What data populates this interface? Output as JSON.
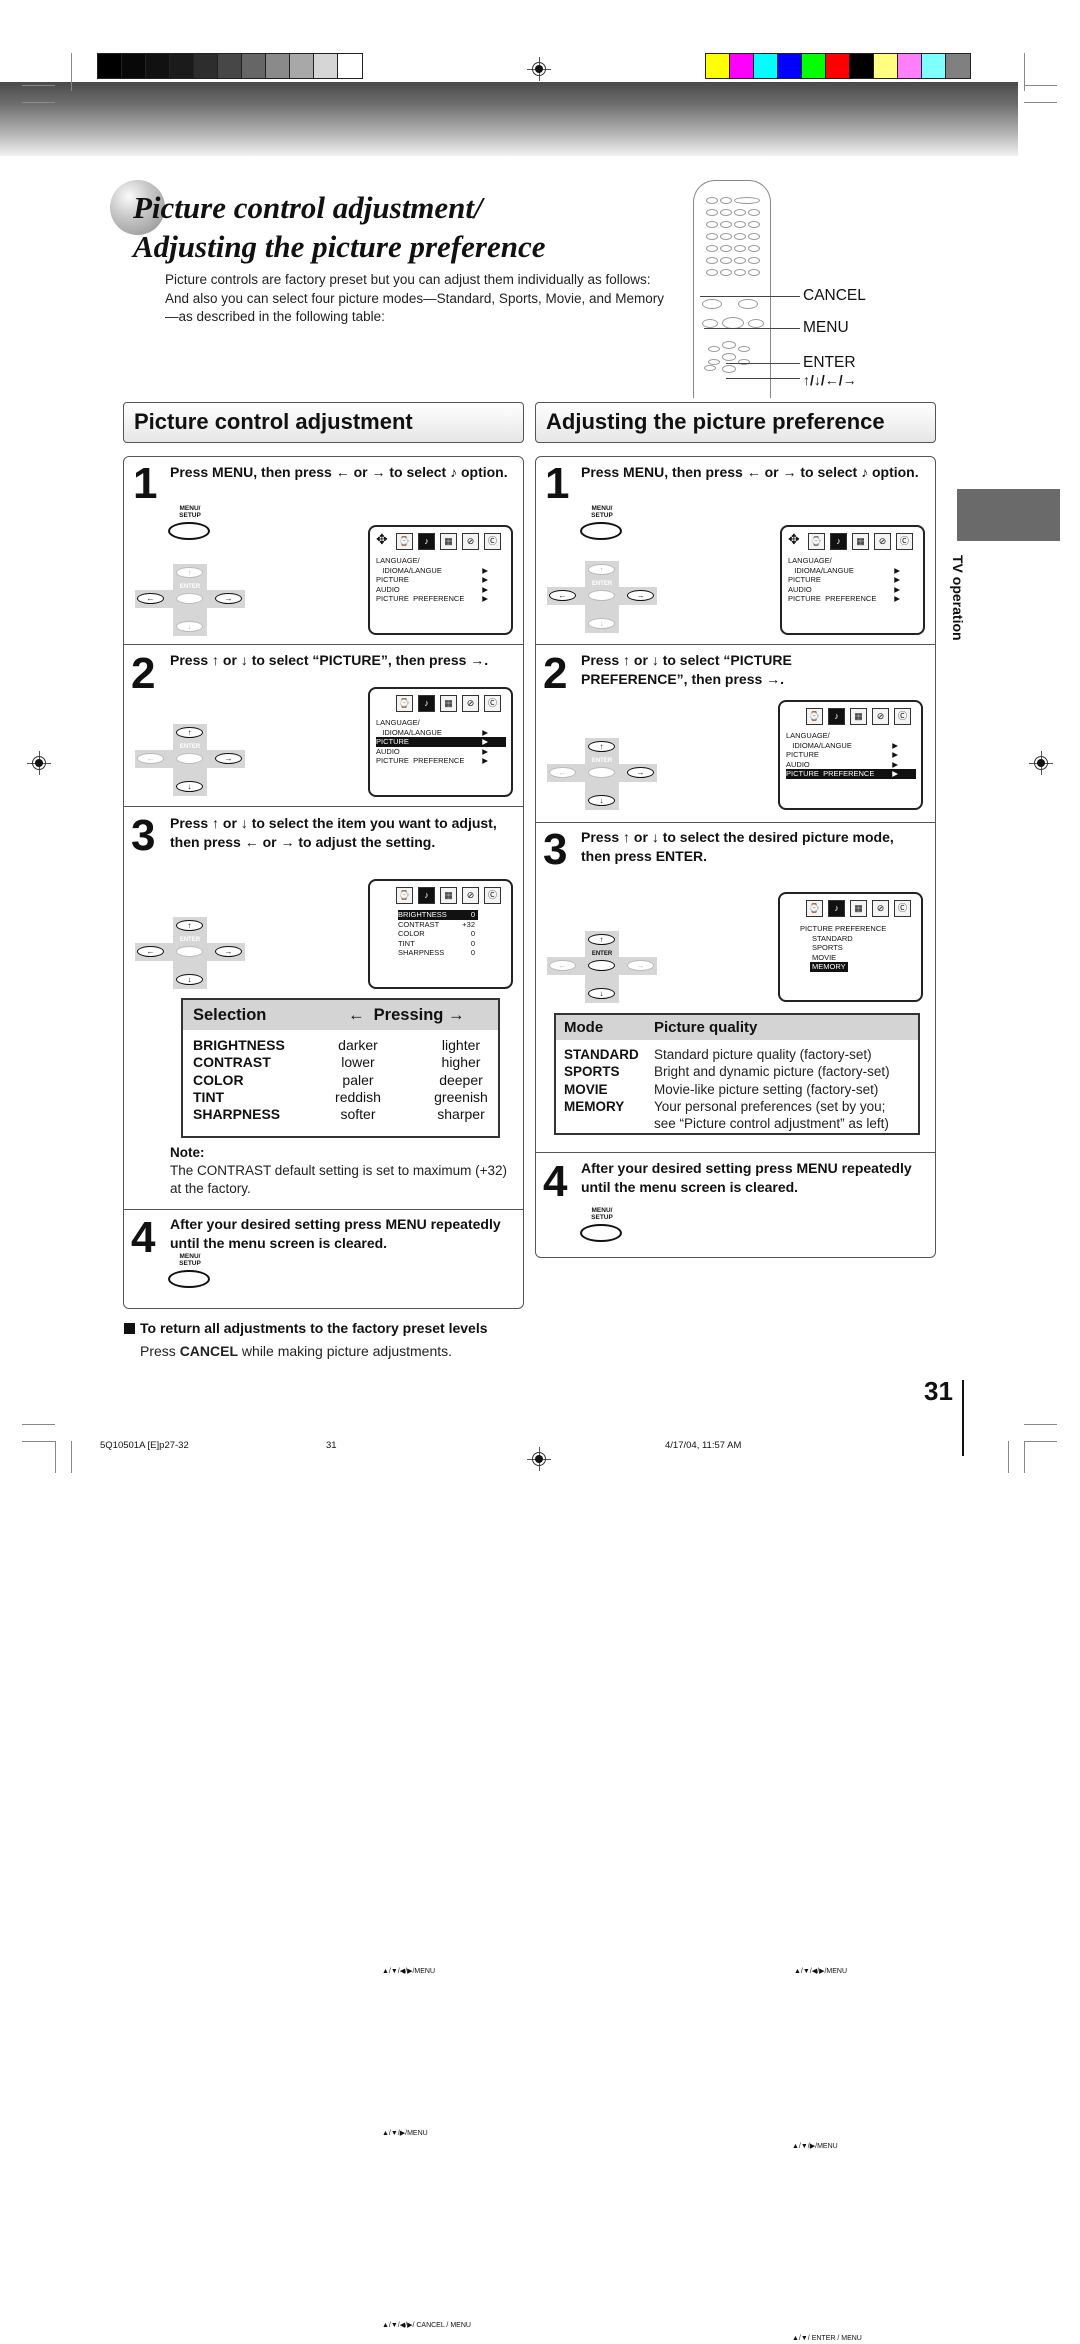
{
  "header": {
    "grayscale_swatches": [
      "#000000",
      "#080808",
      "#111111",
      "#1b1b1b",
      "#2d2d2d",
      "#474747",
      "#666666",
      "#8a8a8a",
      "#a8a8a8",
      "#d6d6d6",
      "#ffffff"
    ],
    "color_swatches": [
      "#ffff00",
      "#ff00ff",
      "#00ffff",
      "#0000ff",
      "#00ff00",
      "#ff0000",
      "#000000",
      "#ffff80",
      "#ff80ff",
      "#80ffff",
      "#808080"
    ]
  },
  "title": {
    "line1": "Picture control adjustment/",
    "line2": "Adjusting the picture preference"
  },
  "intro": {
    "p1": "Picture controls are factory preset but you can adjust them individually as follows:",
    "p2": "And also you can select four picture modes—Standard, Sports, Movie, and Memory—as described in the following table:"
  },
  "remote": {
    "labels": {
      "cancel": "CANCEL",
      "menu": "MENU",
      "enter": "ENTER",
      "arrows": "↑/↓/←/→"
    }
  },
  "left_section": {
    "heading": "Picture control adjustment",
    "steps": [
      {
        "num": "1",
        "text": "Press MENU, then press ← or → to select ♪ option."
      },
      {
        "num": "2",
        "text": "Press ↑ or ↓ to select “PICTURE”, then press →."
      },
      {
        "num": "3",
        "text": "Press ↑ or ↓ to select the item you want to adjust, then press ← or → to adjust the setting."
      },
      {
        "num": "4",
        "text": "After your desired setting press MENU repeatedly until the menu screen is cleared."
      }
    ],
    "selection_table": {
      "headers": {
        "selection": "Selection",
        "pressing": "←  Pressing →"
      },
      "rows": [
        {
          "item": "BRIGHTNESS",
          "left": "darker",
          "right": "lighter"
        },
        {
          "item": "CONTRAST",
          "left": "lower",
          "right": "higher"
        },
        {
          "item": "COLOR",
          "left": "paler",
          "right": "deeper"
        },
        {
          "item": "TINT",
          "left": "reddish",
          "right": "greenish"
        },
        {
          "item": "SHARPNESS",
          "left": "softer",
          "right": "sharper"
        }
      ]
    },
    "note": {
      "heading": "Note:",
      "text": "The CONTRAST default setting is set to maximum (+32) at the factory."
    },
    "factory_reset": {
      "heading": "To return all adjustments to the factory preset levels",
      "text_pre": "Press ",
      "text_bold": "CANCEL",
      "text_post": " while making picture adjustments."
    }
  },
  "right_section": {
    "heading": "Adjusting the picture preference",
    "steps": [
      {
        "num": "1",
        "text": "Press MENU, then press ← or → to select ♪ option."
      },
      {
        "num": "2",
        "text": "Press ↑ or ↓ to select “PICTURE PREFERENCE”, then press →."
      },
      {
        "num": "3",
        "text": "Press ↑ or ↓ to select the desired picture mode, then press ENTER."
      },
      {
        "num": "4",
        "text": "After your desired setting press MENU repeatedly until the menu screen is cleared."
      }
    ],
    "mode_table": {
      "headers": {
        "mode": "Mode",
        "quality": "Picture quality"
      },
      "rows": [
        {
          "mode": "STANDARD",
          "desc": "Standard picture quality (factory-set)"
        },
        {
          "mode": "SPORTS",
          "desc": "Bright and dynamic picture (factory-set)"
        },
        {
          "mode": "MOVIE",
          "desc": "Movie-like picture setting (factory-set)"
        },
        {
          "mode": "MEMORY",
          "desc": "Your personal preferences (set by you;"
        },
        {
          "mode": "",
          "desc": "see “Picture control adjustment” as left)"
        }
      ]
    }
  },
  "controls": {
    "menu_setup_label": "MENU/\nSETUP",
    "enter_label": "ENTER"
  },
  "osd": {
    "main_menu": {
      "items": [
        {
          "label": "LANGUAGE/",
          "arrow": ""
        },
        {
          "label": "   IDIOMA/LANGUE",
          "arrow": "▶"
        },
        {
          "label": "PICTURE",
          "arrow": "▶"
        },
        {
          "label": "AUDIO",
          "arrow": "▶"
        },
        {
          "label": "PICTURE  PREFERENCE",
          "arrow": "▶"
        }
      ],
      "footer_full": "▲/▼/◀/▶/MENU",
      "footer_short": "▲/▼/▶/MENU"
    },
    "picture_menu": {
      "items": [
        {
          "label": "BRIGHTNESS",
          "value": "0"
        },
        {
          "label": "CONTRAST",
          "value": "+32"
        },
        {
          "label": "COLOR",
          "value": "0"
        },
        {
          "label": "TINT",
          "value": "0"
        },
        {
          "label": "SHARPNESS",
          "value": "0"
        }
      ],
      "footer": "▲/▼/◀/▶/ CANCEL / MENU"
    },
    "preference_menu": {
      "title": "PICTURE PREFERENCE",
      "items": [
        "STANDARD",
        "SPORTS",
        "MOVIE",
        "MEMORY"
      ],
      "selected": "MEMORY",
      "footer": "▲/▼/ ENTER / MENU"
    },
    "icons": [
      "clock-icon",
      "picture-icon",
      "grid-icon",
      "lock-icon",
      "cc-icon"
    ],
    "icon_glyphs": [
      "⌚",
      "♪",
      "▦",
      "⊘",
      "Ⓒ"
    ]
  },
  "side_tab": {
    "label": "TV operation"
  },
  "page_number": "31",
  "footer": {
    "file": "5Q10501A [E]p27-32",
    "page": "31",
    "timestamp": "4/17/04, 11:57 AM"
  }
}
